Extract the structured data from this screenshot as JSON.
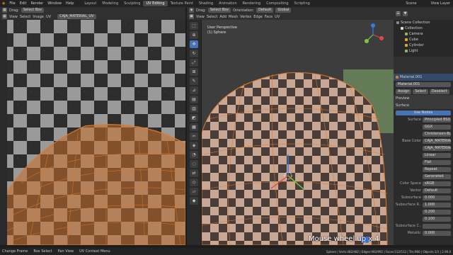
{
  "topbar": {
    "menus": [
      "File",
      "Edit",
      "Render",
      "Window",
      "Help"
    ],
    "workspaces": [
      {
        "label": "Layout",
        "on": false
      },
      {
        "label": "Modeling",
        "on": false
      },
      {
        "label": "Sculpting",
        "on": false
      },
      {
        "label": "UV Editing",
        "on": true
      },
      {
        "label": "Texture Paint",
        "on": false
      },
      {
        "label": "Shading",
        "on": false
      },
      {
        "label": "Animation",
        "on": false
      },
      {
        "label": "Rendering",
        "on": false
      },
      {
        "label": "Compositing",
        "on": false
      },
      {
        "label": "Scripting",
        "on": false
      }
    ],
    "scene": "Scene",
    "view_layer": "View Layer"
  },
  "uv_header": {
    "drag": "Drag:",
    "select_box": "Select Box",
    "menus": [
      "View",
      "Select",
      "Image",
      "UV"
    ],
    "image_name": "CAJA_MATERIAL_UV"
  },
  "vp_header": {
    "drag": "Drag:",
    "select_box": "Select Box",
    "orientation_label": "Orientation:",
    "orientation": "Default",
    "global": "Global",
    "menus": [
      "View",
      "Select",
      "Add",
      "Mesh",
      "Vertex",
      "Edge",
      "Face",
      "UV"
    ]
  },
  "viewport": {
    "perspective": "User Perspective",
    "object": "(1) Sphere"
  },
  "outliner": {
    "items": [
      {
        "label": "Scene Collection",
        "color": "#888"
      },
      {
        "label": "Collection",
        "color": "#ddd"
      },
      {
        "label": "Camera",
        "color": "#8fb36b"
      },
      {
        "label": "Cube",
        "color": "#e3a33c"
      },
      {
        "label": "Cylinder",
        "color": "#e3a33c"
      },
      {
        "label": "Light",
        "color": "#8fb36b"
      }
    ]
  },
  "properties": {
    "material_slot": "Material.001",
    "material_name": "Material.001",
    "buttons": [
      "Assign",
      "Select",
      "Deselect"
    ],
    "preview": "Preview",
    "surface_section": "Surface",
    "use_nodes": "Use Nodes",
    "rows": [
      {
        "label": "Surface",
        "value": "Principled BSDF"
      },
      {
        "label": "",
        "value": "GGX"
      },
      {
        "label": "",
        "value": "Christensen-Burley"
      },
      {
        "label": "Base Color",
        "value": "CAJA_MATERIAL_UV"
      },
      {
        "label": "",
        "value": "CAJA_MATERIAL_UV..."
      },
      {
        "label": "",
        "value": "Linear"
      },
      {
        "label": "",
        "value": "Flat"
      },
      {
        "label": "",
        "value": "Repeat"
      },
      {
        "label": "",
        "value": "Generated"
      },
      {
        "label": "Color Space",
        "value": "sRGB"
      },
      {
        "label": "Vector",
        "value": "Default"
      },
      {
        "label": "Subsurface",
        "value": "0.000"
      },
      {
        "label": "Subsurface R...",
        "value": "1.000"
      },
      {
        "label": "",
        "value": "0.200"
      },
      {
        "label": "",
        "value": "0.100"
      },
      {
        "label": "Subsurface C...",
        "value": ""
      },
      {
        "label": "Metallic",
        "value": "0.000"
      }
    ]
  },
  "status": {
    "items": [
      "Change Frame",
      "Box Select",
      "Pan View",
      "UV Context Menu"
    ],
    "right": "Sphere | Verts:482/482 | Edges:992/992 | Faces:512/512 | Tris:960 | Objects:1/1 | 2.90.0"
  },
  "overlay_text": "Mouse wheel up x 4",
  "colors": {
    "accent": "#4772b3",
    "selection": "#e07a2a"
  }
}
